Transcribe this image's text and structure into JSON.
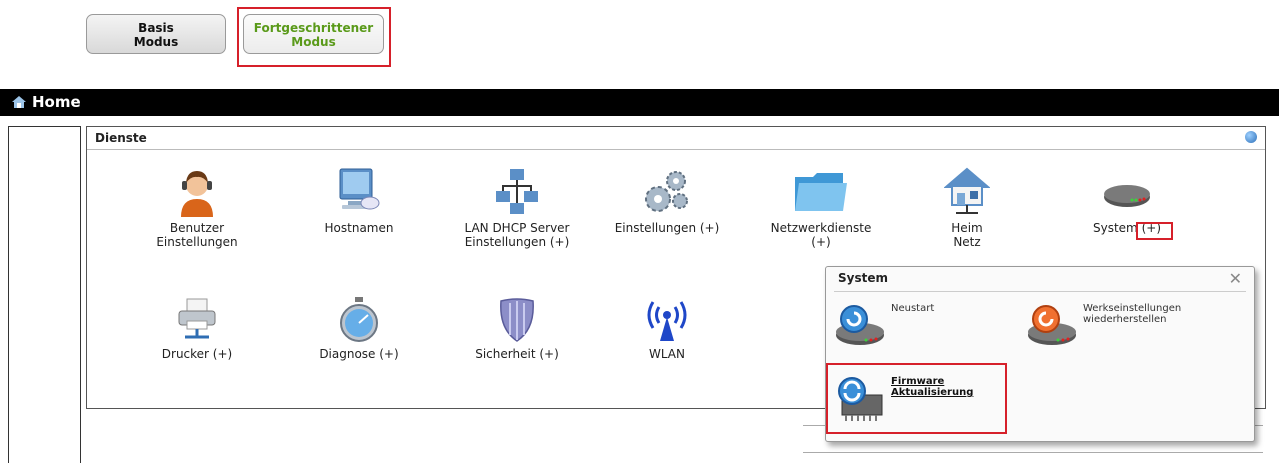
{
  "modes": {
    "basic": {
      "line1": "Basis",
      "line2": "Modus"
    },
    "advanced": {
      "line1": "Fortgeschrittener",
      "line2": "Modus"
    }
  },
  "home_bar": {
    "title": "Home",
    "icon": "home-icon"
  },
  "dienste": {
    "title": "Dienste",
    "help_icon": "globe-help-icon",
    "items": [
      {
        "line1": "Benutzer",
        "line2": "Einstellungen",
        "icon": "user-headset-icon"
      },
      {
        "line1": "Hostnamen",
        "line2": "",
        "icon": "monitor-icon"
      },
      {
        "line1": "LAN DHCP Server",
        "line2": "Einstellungen (+)",
        "icon": "network-computers-icon"
      },
      {
        "line1": "Einstellungen (+)",
        "line2": "",
        "icon": "gears-icon"
      },
      {
        "line1": "Netzwerkdienste",
        "line2": "(+)",
        "icon": "folder-icon"
      },
      {
        "line1": "Heim",
        "line2": "Netz",
        "icon": "home-network-icon"
      },
      {
        "line1": "System",
        "line2": "(+)",
        "icon": "router-icon"
      },
      {
        "line1": "Drucker (+)",
        "line2": "",
        "icon": "printer-icon"
      },
      {
        "line1": "Diagnose (+)",
        "line2": "",
        "icon": "stopwatch-icon"
      },
      {
        "line1": "Sicherheit (+)",
        "line2": "",
        "icon": "shield-icon"
      },
      {
        "line1": "WLAN",
        "line2": "",
        "icon": "wireless-icon"
      }
    ]
  },
  "system_popup": {
    "title": "System",
    "close_glyph": "✕",
    "items": [
      {
        "line1": "Neustart",
        "line2": "",
        "icon": "router-restart-icon"
      },
      {
        "line1": "Werkseinstellungen",
        "line2": "wiederherstellen",
        "icon": "router-reset-icon"
      },
      {
        "line1": "Firmware",
        "line2": "Aktualisierung",
        "icon": "firmware-chip-icon"
      }
    ]
  },
  "colors": {
    "accent_green": "#5a9a1a",
    "highlight_red": "#d6202a",
    "header_black": "#000000"
  }
}
